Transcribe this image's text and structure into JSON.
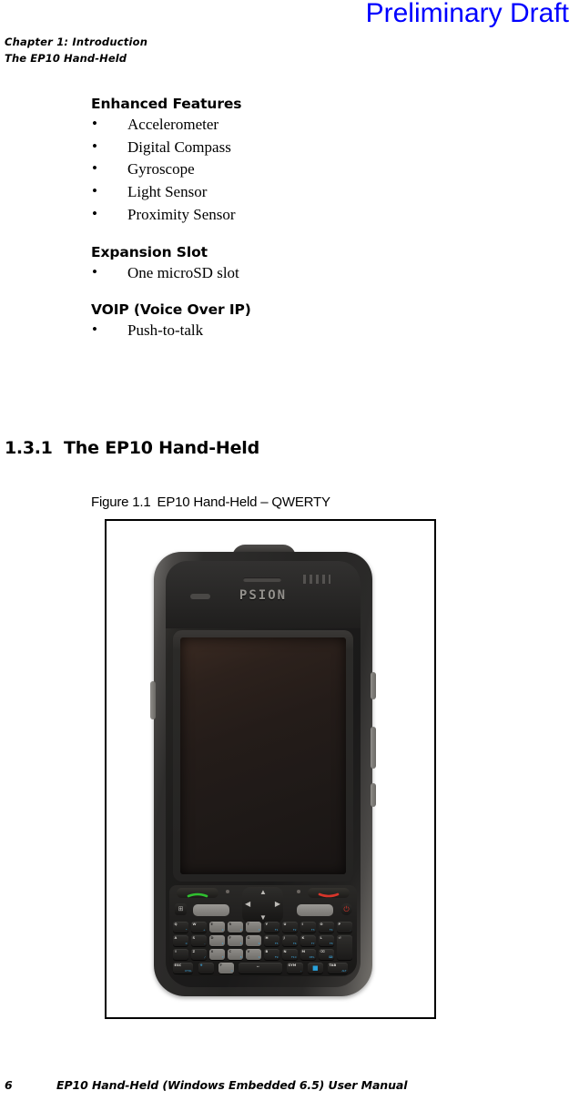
{
  "header": {
    "draft_stamp": "Preliminary Draft",
    "chapter": "Chapter 1: Introduction",
    "section": "The EP10 Hand-Held",
    "draft_color": "#0000ff"
  },
  "content": {
    "groups": [
      {
        "heading": "Enhanced Features",
        "bullet": "•",
        "items": [
          "Accelerometer",
          "Digital Compass",
          "Gyroscope",
          "Light Sensor",
          "Proximity Sensor"
        ]
      },
      {
        "heading": "Expansion Slot",
        "bullet": "•",
        "items": [
          "One microSD slot"
        ]
      },
      {
        "heading": "VOIP (Voice Over IP)",
        "bullet": "•",
        "items": [
          "Push-to-talk"
        ]
      }
    ]
  },
  "section_block": {
    "number": "1.3.1",
    "title": "The EP10 Hand-Held"
  },
  "figure": {
    "label": "Figure 1.1",
    "caption": "EP10 Hand-Held – QWERTY",
    "device": {
      "brand_logo": "PSION",
      "screen_state": "blank-dark",
      "keyboard_layout": "QWERTY",
      "keys": {
        "row1": [
          {
            "primary": "Q",
            "secondary": "*"
          },
          {
            "primary": "W",
            "secondary": "+"
          },
          {
            "primary": "E",
            "secondary": "1"
          },
          {
            "primary": "R",
            "secondary": "2"
          },
          {
            "primary": "T",
            "secondary": "3"
          },
          {
            "primary": "Y",
            "secondary": "F1"
          },
          {
            "primary": "U",
            "secondary": "F2"
          },
          {
            "primary": "I",
            "secondary": "F3"
          },
          {
            "primary": "O",
            "secondary": "F4"
          },
          {
            "primary": "P",
            "secondary": "."
          }
        ],
        "row2": [
          {
            "primary": "A",
            "secondary": "0"
          },
          {
            "primary": "S",
            "secondary": "-"
          },
          {
            "primary": "D",
            "secondary": "4"
          },
          {
            "primary": "F",
            "secondary": "5"
          },
          {
            "primary": "G",
            "secondary": "6"
          },
          {
            "primary": "H",
            "secondary": "F5"
          },
          {
            "primary": "J",
            "secondary": "F6"
          },
          {
            "primary": "K",
            "secondary": "F7"
          },
          {
            "primary": "L",
            "secondary": "F8"
          },
          {
            "primary": "⏎",
            "secondary": ""
          }
        ],
        "row3": [
          {
            "primary": "⇧",
            "secondary": ""
          },
          {
            "primary": "Z",
            "secondary": "/"
          },
          {
            "primary": "X",
            "secondary": "7"
          },
          {
            "primary": "C",
            "secondary": "8"
          },
          {
            "primary": "V",
            "secondary": "9"
          },
          {
            "primary": "B",
            "secondary": "F9"
          },
          {
            "primary": "N",
            "secondary": "F10"
          },
          {
            "primary": "M",
            "secondary": "DEL"
          },
          {
            "primary": "⌫",
            "secondary": "⌨"
          }
        ],
        "row4": [
          {
            "primary": "ESC",
            "secondary": "CTRL"
          },
          {
            "primary": "❖",
            "secondary": ""
          },
          {
            "primary": "F",
            "secondary": "n"
          },
          {
            "primary": "␣",
            "secondary": ""
          },
          {
            "primary": "SYM",
            "secondary": ".."
          },
          {
            "primary": "■",
            "secondary": ""
          },
          {
            "primary": "TAB",
            "secondary": "ALT"
          }
        ]
      },
      "controls": {
        "call_key": "call-send",
        "end_key": "call-end",
        "dpad": [
          "up",
          "down",
          "left",
          "right"
        ],
        "power": "⏻",
        "windows_key": "⊞",
        "soft_keys": [
          "left-soft-key",
          "right-soft-key"
        ]
      }
    }
  },
  "footer": {
    "page_number": "6",
    "text": "EP10 Hand-Held (Windows Embedded 6.5) User Manual"
  }
}
